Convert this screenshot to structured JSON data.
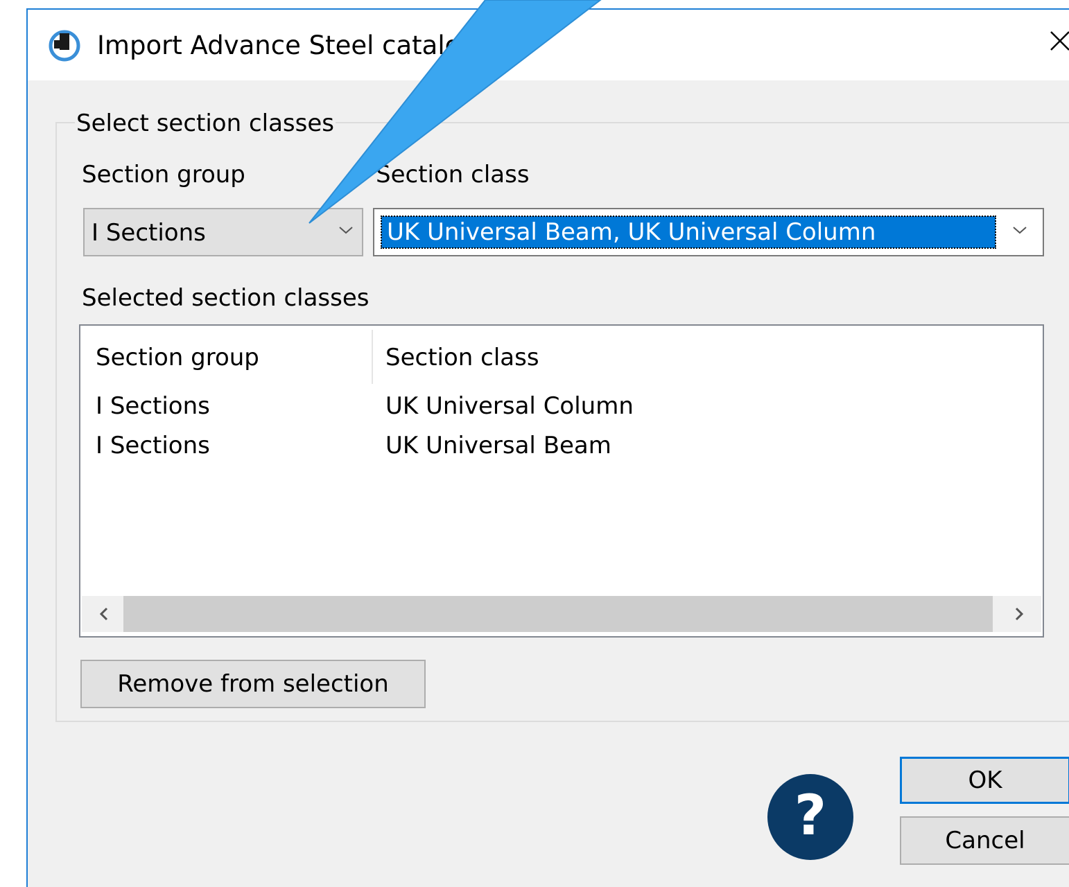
{
  "window": {
    "title": "Import Advance Steel catalog",
    "close_symbol": "✕"
  },
  "section_select": {
    "legend": "Select section classes",
    "group_label": "Section group",
    "class_label": "Section class",
    "group_value": "I Sections",
    "class_value": "UK Universal Beam, UK Universal Column"
  },
  "selected": {
    "label": "Selected section classes",
    "columns": [
      "Section group",
      "Section class"
    ],
    "rows": [
      [
        "I Sections",
        "UK Universal Column"
      ],
      [
        "I Sections",
        "UK Universal Beam"
      ]
    ]
  },
  "buttons": {
    "remove": "Remove from selection",
    "ok": "OK",
    "cancel": "Cancel",
    "help": "?"
  },
  "colors": {
    "accent": "#0078d7",
    "callout": "#3aa6f0",
    "help_bg": "#0b3a66"
  },
  "icons": [
    "app-icon",
    "close-icon",
    "chevron-down-icon",
    "chevron-left-icon",
    "chevron-right-icon",
    "help-icon"
  ]
}
